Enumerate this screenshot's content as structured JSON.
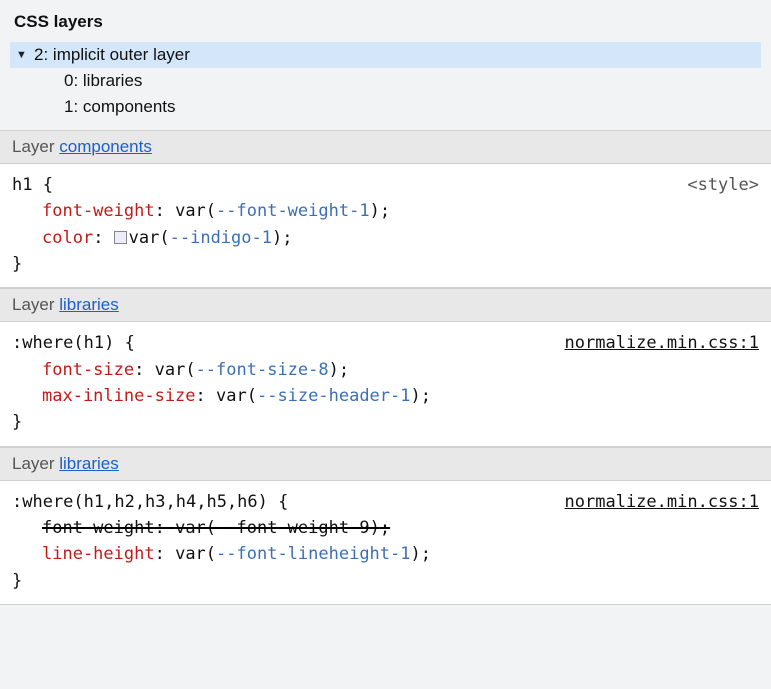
{
  "title": "CSS layers",
  "tree": {
    "root": {
      "index": "2",
      "label": "implicit outer layer"
    },
    "children": [
      {
        "index": "0",
        "label": "libraries"
      },
      {
        "index": "1",
        "label": "components"
      }
    ]
  },
  "layer_label": "Layer",
  "blocks": [
    {
      "layer_link": "components",
      "selector": "h1",
      "open_brace": "{",
      "close_brace": "}",
      "source": "<style>",
      "source_is_link": false,
      "props": [
        {
          "name": "font-weight",
          "func": "var",
          "var": "--font-weight-1",
          "swatch": false,
          "struck": false
        },
        {
          "name": "color",
          "func": "var",
          "var": "--indigo-1",
          "swatch": true,
          "struck": false
        }
      ]
    },
    {
      "layer_link": "libraries",
      "selector": ":where(h1)",
      "open_brace": "{",
      "close_brace": "}",
      "source": "normalize.min.css:1",
      "source_is_link": true,
      "props": [
        {
          "name": "font-size",
          "func": "var",
          "var": "--font-size-8",
          "swatch": false,
          "struck": false
        },
        {
          "name": "max-inline-size",
          "func": "var",
          "var": "--size-header-1",
          "swatch": false,
          "struck": false
        }
      ]
    },
    {
      "layer_link": "libraries",
      "selector": ":where(h1,h2,h3,h4,h5,h6)",
      "open_brace": "{",
      "close_brace": "}",
      "source": "normalize.min.css:1",
      "source_is_link": true,
      "props": [
        {
          "name": "font-weight",
          "func": "var",
          "var": "--font-weight-9",
          "swatch": false,
          "struck": true
        },
        {
          "name": "line-height",
          "func": "var",
          "var": "--font-lineheight-1",
          "swatch": false,
          "struck": false
        }
      ]
    }
  ]
}
